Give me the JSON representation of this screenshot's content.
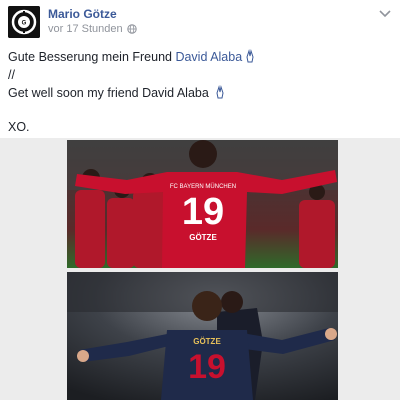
{
  "post": {
    "author": "Mario Götze",
    "timestamp": "vor 17 Stunden",
    "privacy_icon": "globe-icon",
    "menu_icon": "chevron-down-icon",
    "avatar_icon": "gotze-logo",
    "message": {
      "line1_text": "Gute Besserung mein Freund ",
      "line1_link": "David Alaba",
      "separator": "//",
      "line2_text": "Get well soon my friend David Alaba",
      "signoff": "XO."
    },
    "photos": [
      {
        "jersey_top": "FC BAYERN MÜNCHEN",
        "number": "19",
        "name": "GÖTZE"
      },
      {
        "name": "GÖTZE",
        "number": "19"
      }
    ]
  },
  "colors": {
    "link": "#3b5998",
    "meta": "#90949c",
    "jersey_red": "#c8102e",
    "jersey_navy": "#1f2a4a"
  }
}
